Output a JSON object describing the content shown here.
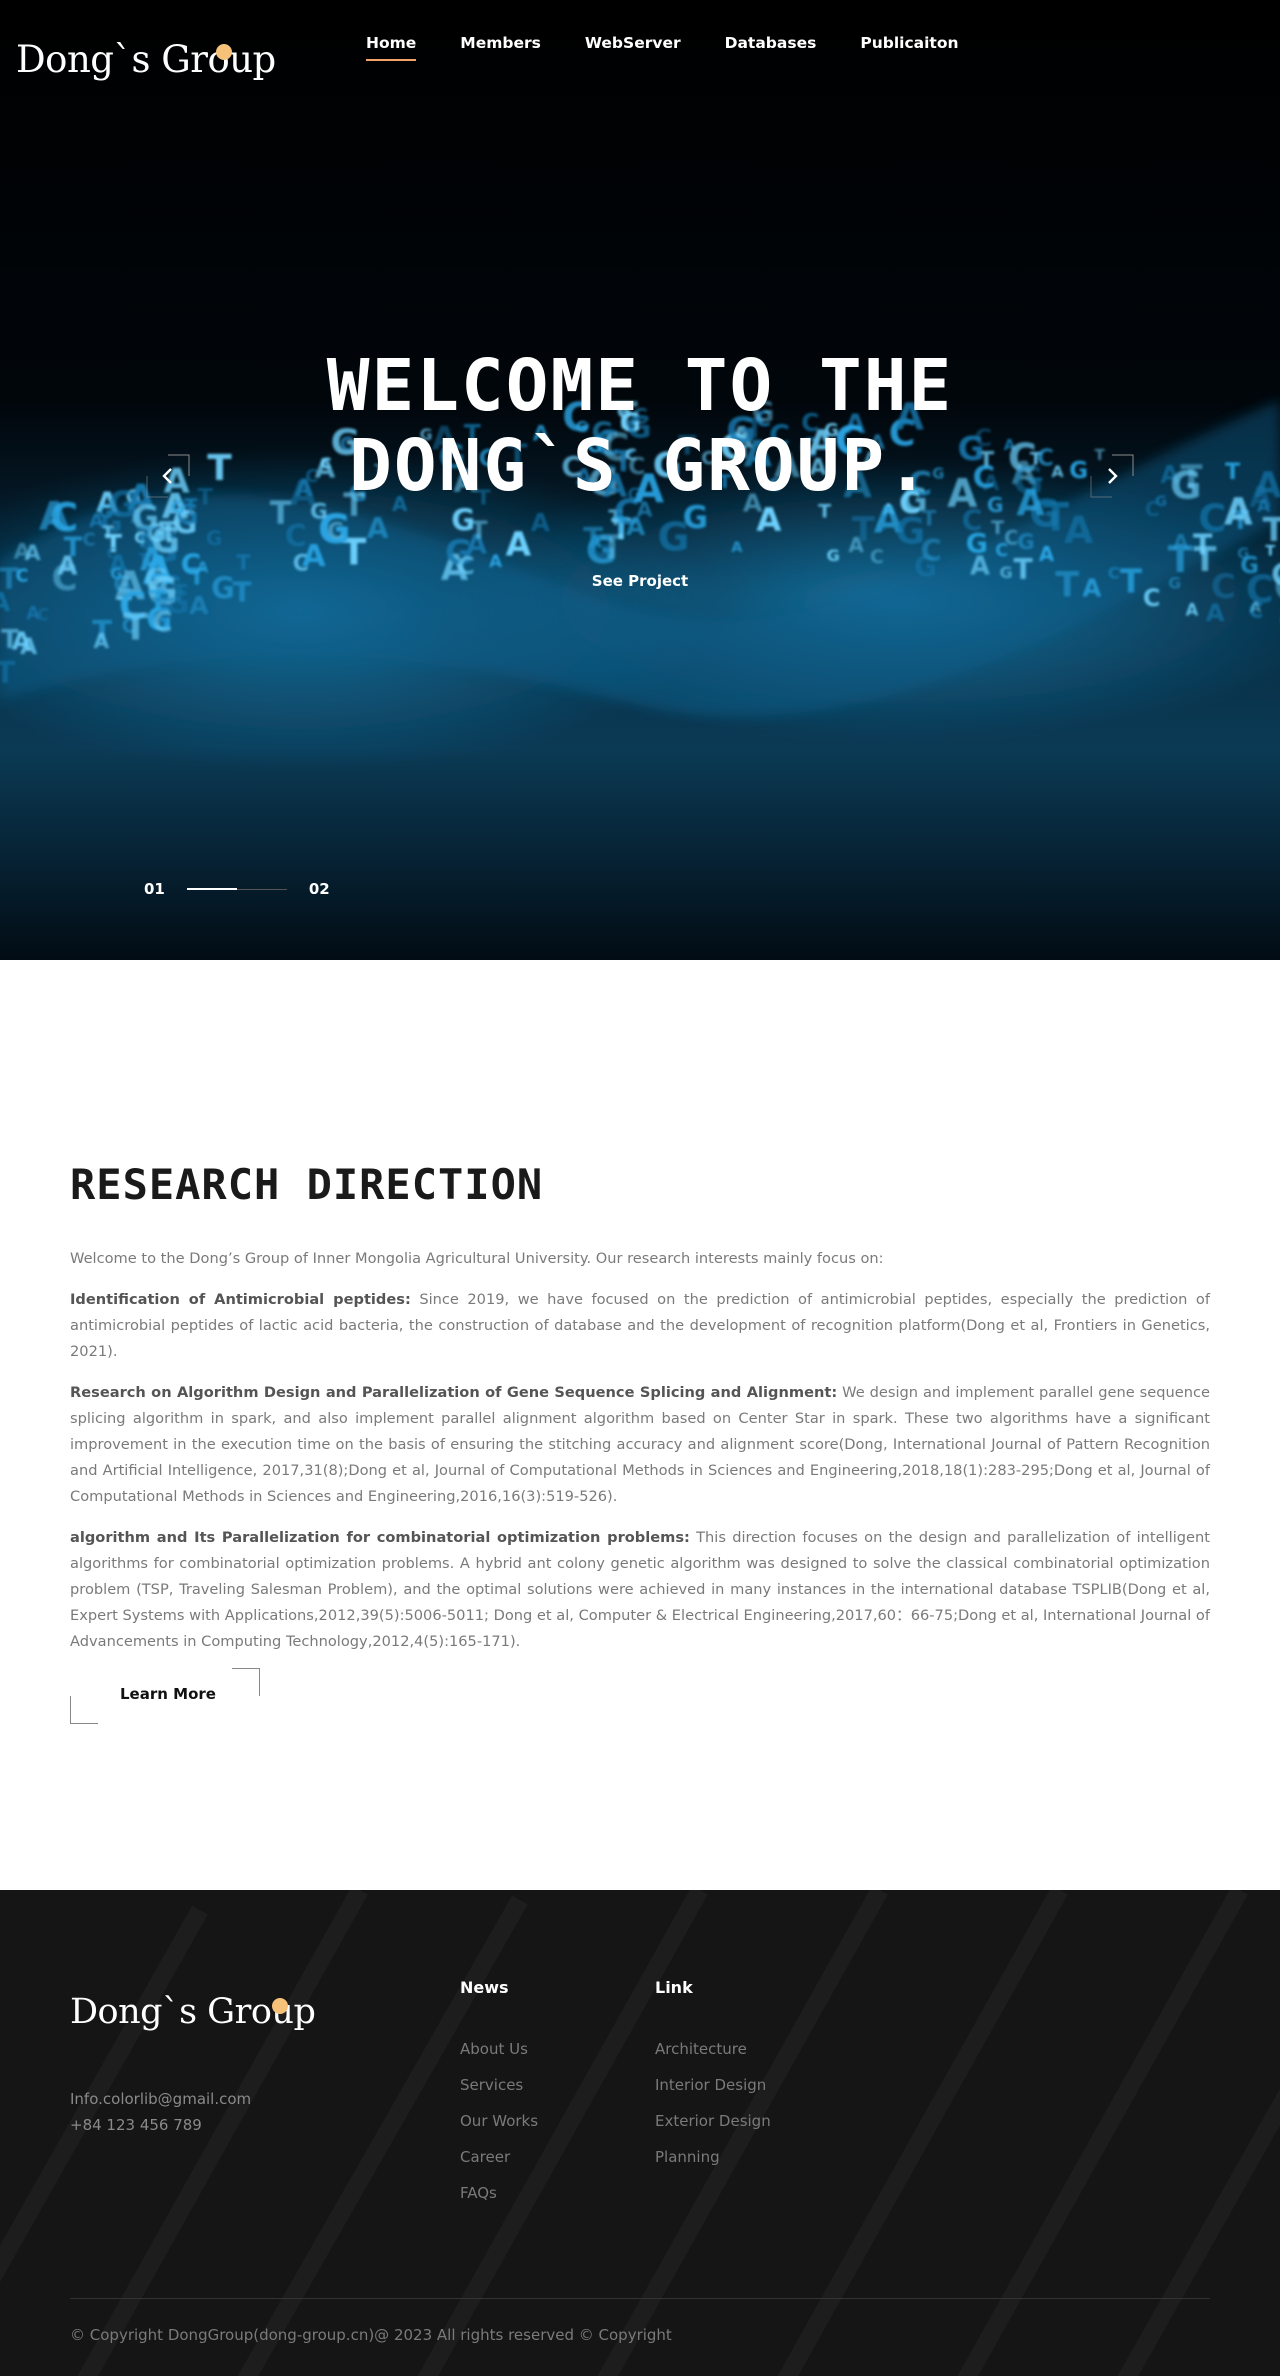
{
  "brand": {
    "name": "Dong`s Group",
    "accent_color": "#f6c27a"
  },
  "nav": {
    "items": [
      {
        "label": "Home",
        "active": true
      },
      {
        "label": "Members",
        "active": false
      },
      {
        "label": "WebServer",
        "active": false
      },
      {
        "label": "Databases",
        "active": false
      },
      {
        "label": "Publicaiton",
        "active": false
      }
    ]
  },
  "hero": {
    "title_line1": "WELCOME TO THE",
    "title_line2": "DONG`S GROUP.",
    "cta": "See Project",
    "slide_current": "01",
    "slide_total": "02",
    "prev_icon": "chevron-left-icon",
    "next_icon": "chevron-right-icon",
    "accent_color": "#1fa6e8"
  },
  "research": {
    "title": "RESEARCH DIRECTION",
    "intro": "Welcome to the Dong’s Group of Inner Mongolia Agricultural University. Our research interests mainly focus on:",
    "items": [
      {
        "heading": "Identification of Antimicrobial peptides:",
        "text": " Since 2019, we have focused on the prediction of antimicrobial peptides, especially the prediction of antimicrobial peptides of lactic acid bacteria, the construction of database and the development of recognition platform(Dong et al, Frontiers in Genetics, 2021)."
      },
      {
        "heading": "Research on Algorithm Design and Parallelization of Gene Sequence Splicing and Alignment:",
        "text": " We design and implement parallel gene sequence splicing algorithm in spark, and also implement parallel alignment algorithm based on Center Star in spark. These two algorithms have a significant improvement in the execution time on the basis of ensuring the stitching accuracy and alignment score(Dong, International Journal of Pattern Recognition and Artificial Intelligence, 2017,31(8);Dong et al, Journal of Computational Methods in Sciences and Engineering,2018,18(1):283-295;Dong et al, Journal of Computational Methods in Sciences and Engineering,2016,16(3):519-526)."
      },
      {
        "heading": "algorithm and Its Parallelization for combinatorial optimization problems:",
        "text": " This direction focuses on the design and parallelization of intelligent algorithms for combinatorial optimization problems. A hybrid ant colony genetic algorithm was designed to solve the classical combinatorial optimization problem (TSP, Traveling Salesman Problem), and the optimal solutions were achieved in many instances in the international database TSPLIB(Dong et al, Expert Systems with Applications,2012,39(5):5006-5011; Dong et al, Computer & Electrical Engineering,2017,60：66-75;Dong et al, International Journal of Advancements in Computing Technology,2012,4(5):165-171)."
      }
    ],
    "learn_more": "Learn More"
  },
  "footer": {
    "brand": "Dong`s Group",
    "email": "Info.colorlib@gmail.com",
    "phone": "+84 123 456 789",
    "news": {
      "heading": "News",
      "links": [
        "About Us",
        "Services",
        "Our Works",
        "Career",
        "FAQs"
      ]
    },
    "link": {
      "heading": "Link",
      "links": [
        "Architecture",
        "Interior Design",
        "Exterior Design",
        "Planning"
      ]
    },
    "copyright": "© Copyright DongGroup(dong-group.cn)@ 2023 All rights reserved © Copyright"
  }
}
